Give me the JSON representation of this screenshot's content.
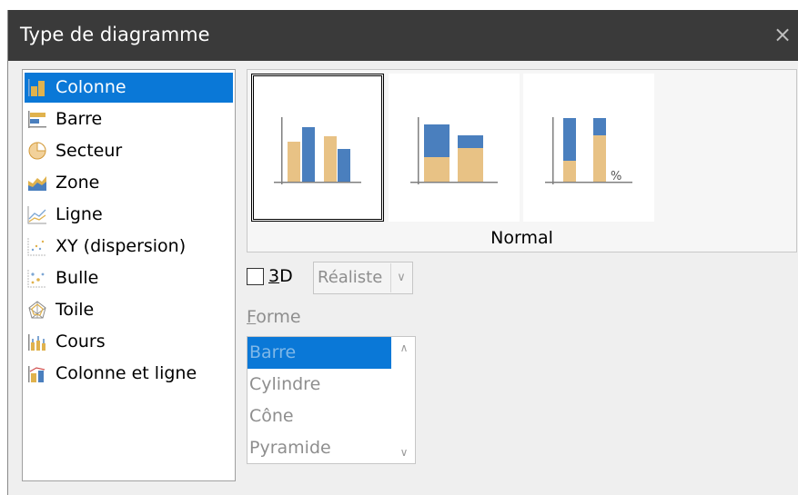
{
  "window": {
    "title": "Type de diagramme",
    "close_glyph": "×"
  },
  "chart_types": {
    "selected": 0,
    "items": [
      {
        "label": "Colonne",
        "icon": "column-chart-icon"
      },
      {
        "label": "Barre",
        "icon": "bar-chart-icon"
      },
      {
        "label": "Secteur",
        "icon": "pie-chart-icon"
      },
      {
        "label": "Zone",
        "icon": "area-chart-icon"
      },
      {
        "label": "Ligne",
        "icon": "line-chart-icon"
      },
      {
        "label": "XY (dispersion)",
        "icon": "xy-scatter-chart-icon"
      },
      {
        "label": "Bulle",
        "icon": "bubble-chart-icon"
      },
      {
        "label": "Toile",
        "icon": "net-chart-icon"
      },
      {
        "label": "Cours",
        "icon": "stock-chart-icon"
      },
      {
        "label": "Colonne et ligne",
        "icon": "column-and-line-chart-icon"
      }
    ]
  },
  "variants": {
    "selected_label": "Normal",
    "items": [
      {
        "name": "normal",
        "icon": "normal-column-variant-icon"
      },
      {
        "name": "stacked",
        "icon": "stacked-column-variant-icon"
      },
      {
        "name": "percent-stacked",
        "icon": "percent-stacked-column-variant-icon",
        "percent_mark": "%"
      }
    ]
  },
  "options": {
    "three_d": {
      "checked": false,
      "label_prefix": "",
      "label_accel": "3",
      "label_rest": "D"
    },
    "shape_style": {
      "value": "Réaliste",
      "enabled": false
    }
  },
  "shape": {
    "label_accel": "F",
    "label_rest": "orme",
    "selected": 0,
    "items": [
      "Barre",
      "Cylindre",
      "Cône",
      "Pyramide"
    ]
  },
  "colors": {
    "title_bg": "#3a3a3a",
    "selection": "#0a78d7",
    "bar_blue": "#4a7fbe",
    "bar_tan": "#e8c285",
    "dialog_bg": "#efefef"
  }
}
